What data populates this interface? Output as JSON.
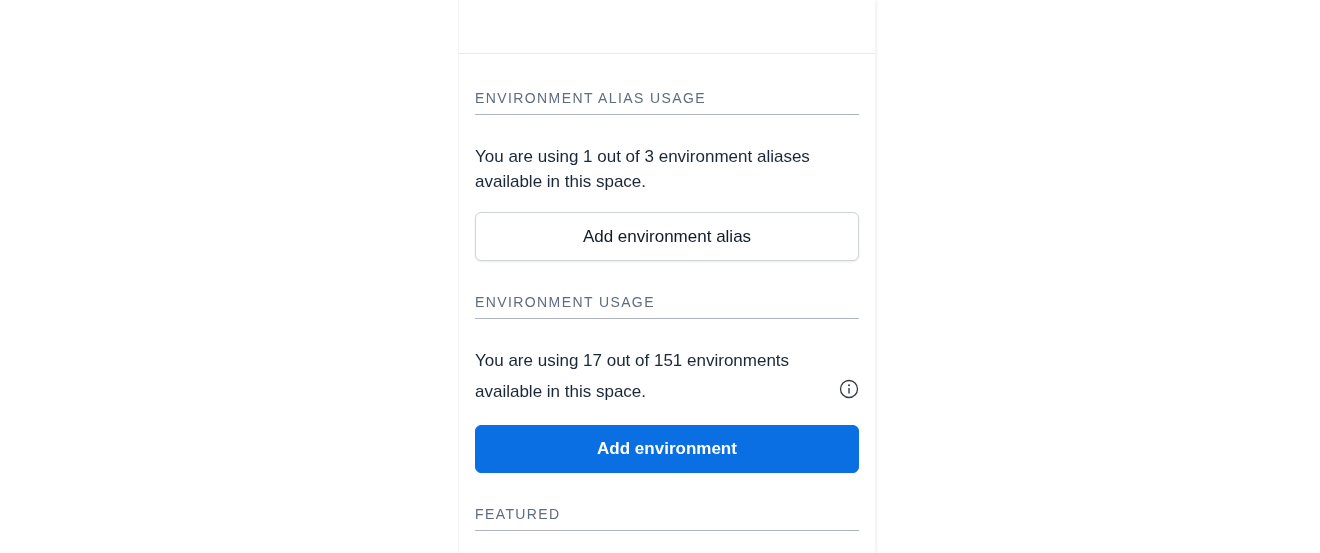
{
  "sections": [
    {
      "heading": "ENVIRONMENT ALIAS USAGE",
      "text": "You are using 1 out of 3 environment aliases available in this space.",
      "button": {
        "label": "Add environment alias",
        "kind": "secondary"
      }
    },
    {
      "heading": "ENVIRONMENT USAGE",
      "text": "You are using 17 out of 151 environments available in this space.",
      "info": true,
      "button": {
        "label": "Add environment",
        "kind": "primary"
      }
    },
    {
      "heading": "FEATURED"
    }
  ]
}
